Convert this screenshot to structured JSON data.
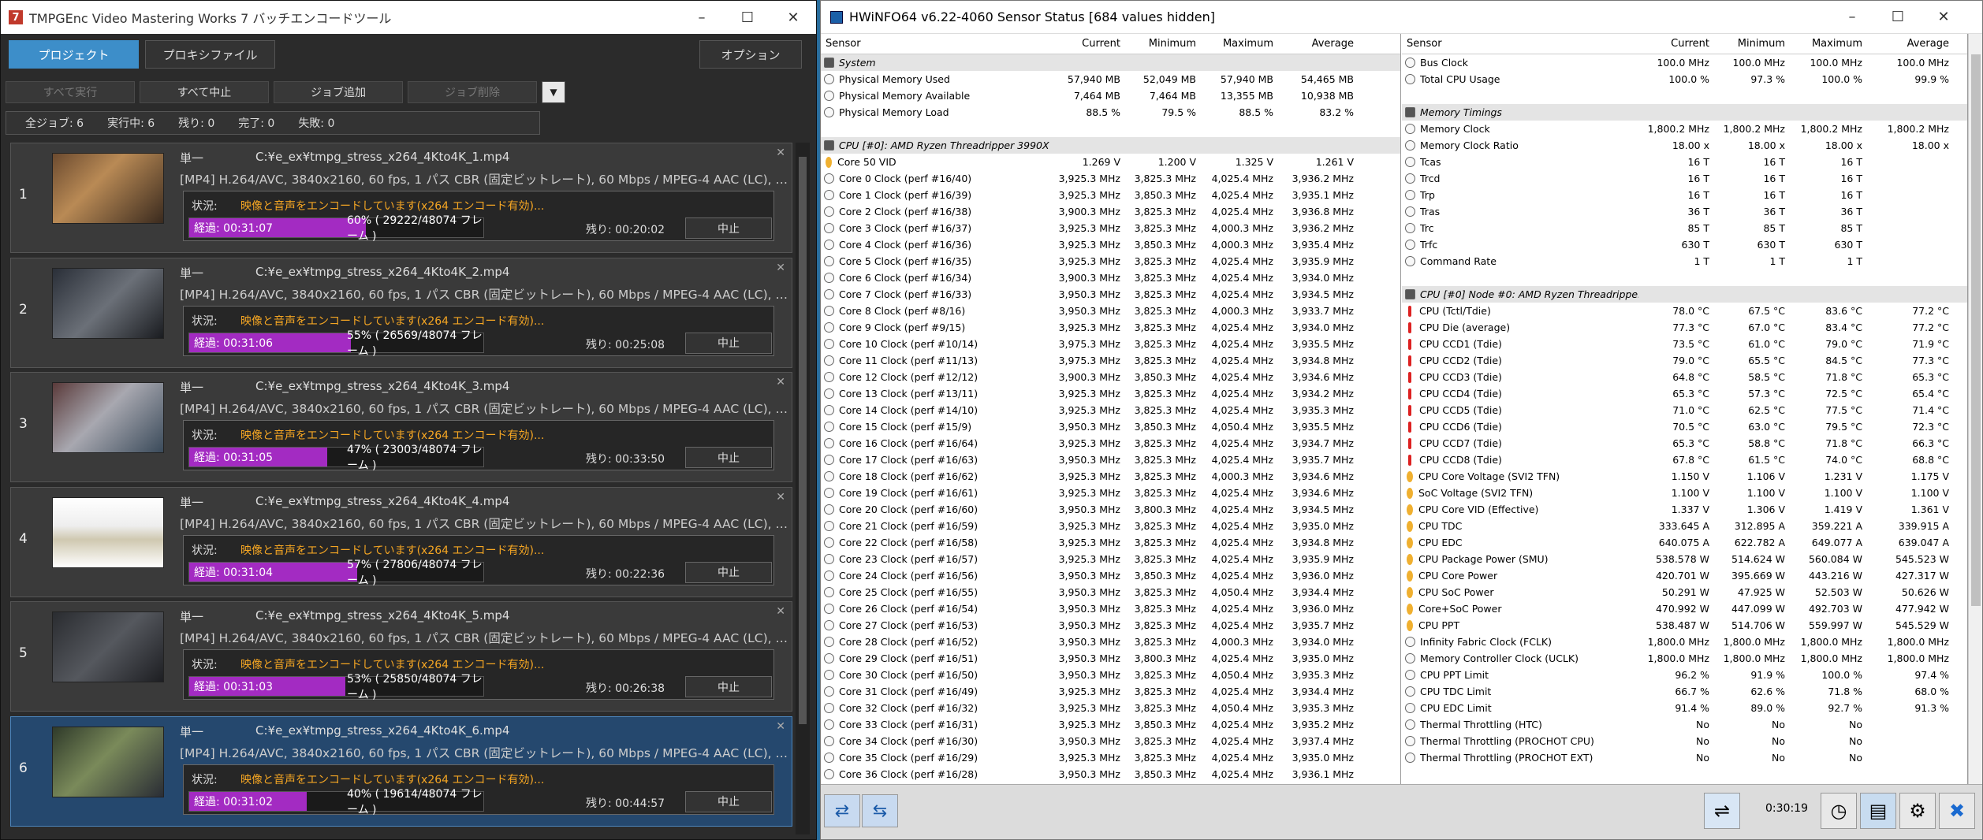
{
  "tmpg": {
    "title": "TMPGEnc Video Mastering Works 7 バッチエンコードツール",
    "tab_project": "プロジェクト",
    "tab_proxy": "プロキシファイル",
    "options": "オプション",
    "btn_run_all": "すべて実行",
    "btn_stop_all": "すべて中止",
    "btn_add_job": "ジョブ追加",
    "btn_delete_job": "ジョブ削除",
    "stats": {
      "total": "全ジョブ: 6",
      "running": "実行中: 6",
      "remaining": "残り: 0",
      "done": "完了: 0",
      "failed": "失敗: 0"
    },
    "status_label": "状況:",
    "stop_label": "中止",
    "job_type": "単一",
    "status_msg": "映像と音声をエンコードしています(x264 エンコード有効)...",
    "jobs": [
      {
        "num": "1",
        "path": "C:¥e_ex¥tmpg_stress_x264_4Kto4K_1.mp4",
        "info": "[MP4] H.264/AVC, 3840x2160, 60 fps, 1 パス CBR (固定ビットレート), 60 Mbps / MPEG-4 AAC (LC), 48000 ...",
        "elapsed": "経過: 00:31:07",
        "pct": "60%",
        "frames": "( 29222/48074 フレーム )",
        "progress": 0.6,
        "remain": "残り: 00:20:02"
      },
      {
        "num": "2",
        "path": "C:¥e_ex¥tmpg_stress_x264_4Kto4K_2.mp4",
        "info": "[MP4] H.264/AVC, 3840x2160, 60 fps, 1 パス CBR (固定ビットレート), 60 Mbps / MPEG-4 AAC (LC), 48000 ...",
        "elapsed": "経過: 00:31:06",
        "pct": "55%",
        "frames": "( 26569/48074 フレーム )",
        "progress": 0.55,
        "remain": "残り: 00:25:08"
      },
      {
        "num": "3",
        "path": "C:¥e_ex¥tmpg_stress_x264_4Kto4K_3.mp4",
        "info": "[MP4] H.264/AVC, 3840x2160, 60 fps, 1 パス CBR (固定ビットレート), 60 Mbps / MPEG-4 AAC (LC), 48000 ...",
        "elapsed": "経過: 00:31:05",
        "pct": "47%",
        "frames": "( 23003/48074 フレーム )",
        "progress": 0.47,
        "remain": "残り: 00:33:50"
      },
      {
        "num": "4",
        "path": "C:¥e_ex¥tmpg_stress_x264_4Kto4K_4.mp4",
        "info": "[MP4] H.264/AVC, 3840x2160, 60 fps, 1 パス CBR (固定ビットレート), 60 Mbps / MPEG-4 AAC (LC), 48000 ...",
        "elapsed": "経過: 00:31:04",
        "pct": "57%",
        "frames": "( 27806/48074 フレーム )",
        "progress": 0.57,
        "remain": "残り: 00:22:36"
      },
      {
        "num": "5",
        "path": "C:¥e_ex¥tmpg_stress_x264_4Kto4K_5.mp4",
        "info": "[MP4] H.264/AVC, 3840x2160, 60 fps, 1 パス CBR (固定ビットレート), 60 Mbps / MPEG-4 AAC (LC), 48000 ...",
        "elapsed": "経過: 00:31:03",
        "pct": "53%",
        "frames": "( 25850/48074 フレーム )",
        "progress": 0.53,
        "remain": "残り: 00:26:38"
      },
      {
        "num": "6",
        "path": "C:¥e_ex¥tmpg_stress_x264_4Kto4K_6.mp4",
        "info": "[MP4] H.264/AVC, 3840x2160, 60 fps, 1 パス CBR (固定ビットレート), 60 Mbps / MPEG-4 AAC (LC), 48000 ...",
        "elapsed": "経過: 00:31:02",
        "pct": "40%",
        "frames": "( 19614/48074 フレーム )",
        "progress": 0.4,
        "remain": "残り: 00:44:57"
      }
    ]
  },
  "hw": {
    "title": "HWiNFO64 v6.22-4060 Sensor Status [684 values hidden]",
    "headers": [
      "Sensor",
      "Current",
      "Minimum",
      "Maximum",
      "Average"
    ],
    "timer": "0:30:19",
    "left": [
      [
        "#s",
        "System"
      ],
      [
        "Physical Memory Used",
        "57,940 MB",
        "52,049 MB",
        "57,940 MB",
        "54,465 MB"
      ],
      [
        "Physical Memory Available",
        "7,464 MB",
        "7,464 MB",
        "13,355 MB",
        "10,938 MB"
      ],
      [
        "Physical Memory Load",
        "88.5 %",
        "79.5 %",
        "88.5 %",
        "83.2 %"
      ],
      [
        "#b"
      ],
      [
        "#s",
        "CPU [#0]: AMD Ryzen Threadripper 3990X"
      ],
      [
        "!Core 50 VID",
        "1.269 V",
        "1.200 V",
        "1.325 V",
        "1.261 V"
      ],
      [
        "Core 0 Clock (perf #16/40)",
        "3,925.3 MHz",
        "3,825.3 MHz",
        "4,025.4 MHz",
        "3,936.2 MHz"
      ],
      [
        "Core 1 Clock (perf #16/39)",
        "3,925.3 MHz",
        "3,850.3 MHz",
        "4,025.4 MHz",
        "3,935.1 MHz"
      ],
      [
        "Core 2 Clock (perf #16/38)",
        "3,900.3 MHz",
        "3,825.3 MHz",
        "4,025.4 MHz",
        "3,936.8 MHz"
      ],
      [
        "Core 3 Clock (perf #16/37)",
        "3,925.3 MHz",
        "3,825.3 MHz",
        "4,000.3 MHz",
        "3,936.2 MHz"
      ],
      [
        "Core 4 Clock (perf #16/36)",
        "3,925.3 MHz",
        "3,850.3 MHz",
        "4,000.3 MHz",
        "3,935.4 MHz"
      ],
      [
        "Core 5 Clock (perf #16/35)",
        "3,925.3 MHz",
        "3,825.3 MHz",
        "4,025.4 MHz",
        "3,935.9 MHz"
      ],
      [
        "Core 6 Clock (perf #16/34)",
        "3,900.3 MHz",
        "3,825.3 MHz",
        "4,025.4 MHz",
        "3,934.0 MHz"
      ],
      [
        "Core 7 Clock (perf #16/33)",
        "3,950.3 MHz",
        "3,825.3 MHz",
        "4,025.4 MHz",
        "3,934.5 MHz"
      ],
      [
        "Core 8 Clock (perf #8/16)",
        "3,950.3 MHz",
        "3,825.3 MHz",
        "4,000.3 MHz",
        "3,933.7 MHz"
      ],
      [
        "Core 9 Clock (perf #9/15)",
        "3,925.3 MHz",
        "3,825.3 MHz",
        "4,025.4 MHz",
        "3,934.0 MHz"
      ],
      [
        "Core 10 Clock (perf #10/14)",
        "3,975.3 MHz",
        "3,825.3 MHz",
        "4,025.4 MHz",
        "3,935.5 MHz"
      ],
      [
        "Core 11 Clock (perf #11/13)",
        "3,975.3 MHz",
        "3,825.3 MHz",
        "4,025.4 MHz",
        "3,934.8 MHz"
      ],
      [
        "Core 12 Clock (perf #12/12)",
        "3,900.3 MHz",
        "3,850.3 MHz",
        "4,025.4 MHz",
        "3,934.6 MHz"
      ],
      [
        "Core 13 Clock (perf #13/11)",
        "3,925.3 MHz",
        "3,825.3 MHz",
        "4,025.4 MHz",
        "3,934.2 MHz"
      ],
      [
        "Core 14 Clock (perf #14/10)",
        "3,925.3 MHz",
        "3,825.3 MHz",
        "4,025.4 MHz",
        "3,935.3 MHz"
      ],
      [
        "Core 15 Clock (perf #15/9)",
        "3,950.3 MHz",
        "3,850.3 MHz",
        "4,050.4 MHz",
        "3,935.5 MHz"
      ],
      [
        "Core 16 Clock (perf #16/64)",
        "3,925.3 MHz",
        "3,825.3 MHz",
        "4,025.4 MHz",
        "3,934.7 MHz"
      ],
      [
        "Core 17 Clock (perf #16/63)",
        "3,950.3 MHz",
        "3,825.3 MHz",
        "4,025.4 MHz",
        "3,935.7 MHz"
      ],
      [
        "Core 18 Clock (perf #16/62)",
        "3,925.3 MHz",
        "3,825.3 MHz",
        "4,000.3 MHz",
        "3,934.6 MHz"
      ],
      [
        "Core 19 Clock (perf #16/61)",
        "3,925.3 MHz",
        "3,825.3 MHz",
        "4,025.4 MHz",
        "3,934.6 MHz"
      ],
      [
        "Core 20 Clock (perf #16/60)",
        "3,950.3 MHz",
        "3,800.3 MHz",
        "4,025.4 MHz",
        "3,934.5 MHz"
      ],
      [
        "Core 21 Clock (perf #16/59)",
        "3,925.3 MHz",
        "3,825.3 MHz",
        "4,025.4 MHz",
        "3,935.0 MHz"
      ],
      [
        "Core 22 Clock (perf #16/58)",
        "3,925.3 MHz",
        "3,825.3 MHz",
        "4,025.4 MHz",
        "3,934.8 MHz"
      ],
      [
        "Core 23 Clock (perf #16/57)",
        "3,925.3 MHz",
        "3,825.3 MHz",
        "4,025.4 MHz",
        "3,935.9 MHz"
      ],
      [
        "Core 24 Clock (perf #16/56)",
        "3,950.3 MHz",
        "3,850.3 MHz",
        "4,025.4 MHz",
        "3,936.0 MHz"
      ],
      [
        "Core 25 Clock (perf #16/55)",
        "3,950.3 MHz",
        "3,825.3 MHz",
        "4,050.4 MHz",
        "3,934.4 MHz"
      ],
      [
        "Core 26 Clock (perf #16/54)",
        "3,950.3 MHz",
        "3,825.3 MHz",
        "4,025.4 MHz",
        "3,936.0 MHz"
      ],
      [
        "Core 27 Clock (perf #16/53)",
        "3,950.3 MHz",
        "3,825.3 MHz",
        "4,025.4 MHz",
        "3,935.7 MHz"
      ],
      [
        "Core 28 Clock (perf #16/52)",
        "3,950.3 MHz",
        "3,825.3 MHz",
        "4,000.3 MHz",
        "3,934.0 MHz"
      ],
      [
        "Core 29 Clock (perf #16/51)",
        "3,950.3 MHz",
        "3,800.3 MHz",
        "4,025.4 MHz",
        "3,935.0 MHz"
      ],
      [
        "Core 30 Clock (perf #16/50)",
        "3,950.3 MHz",
        "3,825.3 MHz",
        "4,050.4 MHz",
        "3,935.3 MHz"
      ],
      [
        "Core 31 Clock (perf #16/49)",
        "3,925.3 MHz",
        "3,825.3 MHz",
        "4,025.4 MHz",
        "3,934.4 MHz"
      ],
      [
        "Core 32 Clock (perf #16/32)",
        "3,925.3 MHz",
        "3,825.3 MHz",
        "4,050.4 MHz",
        "3,935.3 MHz"
      ],
      [
        "Core 33 Clock (perf #16/31)",
        "3,925.3 MHz",
        "3,850.3 MHz",
        "4,025.4 MHz",
        "3,935.2 MHz"
      ],
      [
        "Core 34 Clock (perf #16/30)",
        "3,950.3 MHz",
        "3,825.3 MHz",
        "4,025.4 MHz",
        "3,937.4 MHz"
      ],
      [
        "Core 35 Clock (perf #16/29)",
        "3,925.3 MHz",
        "3,825.3 MHz",
        "4,025.4 MHz",
        "3,935.0 MHz"
      ],
      [
        "Core 36 Clock (perf #16/28)",
        "3,950.3 MHz",
        "3,850.3 MHz",
        "4,025.4 MHz",
        "3,936.1 MHz"
      ]
    ],
    "right": [
      [
        "Bus Clock",
        "100.0 MHz",
        "100.0 MHz",
        "100.0 MHz",
        "100.0 MHz"
      ],
      [
        "Total CPU Usage",
        "100.0 %",
        "97.3 %",
        "100.0 %",
        "99.9 %"
      ],
      [
        "#b"
      ],
      [
        "#s",
        "Memory Timings"
      ],
      [
        "Memory Clock",
        "1,800.2 MHz",
        "1,800.2 MHz",
        "1,800.2 MHz",
        "1,800.2 MHz"
      ],
      [
        "Memory Clock Ratio",
        "18.00 x",
        "18.00 x",
        "18.00 x",
        "18.00 x"
      ],
      [
        "Tcas",
        "16 T",
        "16 T",
        "16 T",
        ""
      ],
      [
        "Trcd",
        "16 T",
        "16 T",
        "16 T",
        ""
      ],
      [
        "Trp",
        "16 T",
        "16 T",
        "16 T",
        ""
      ],
      [
        "Tras",
        "36 T",
        "36 T",
        "36 T",
        ""
      ],
      [
        "Trc",
        "85 T",
        "85 T",
        "85 T",
        ""
      ],
      [
        "Trfc",
        "630 T",
        "630 T",
        "630 T",
        ""
      ],
      [
        "Command Rate",
        "1 T",
        "1 T",
        "1 T",
        ""
      ],
      [
        "#b"
      ],
      [
        "#s",
        "CPU [#0] Node #0: AMD Ryzen Threadripper ..."
      ],
      [
        "^CPU (Tctl/Tdie)",
        "78.0 °C",
        "67.5 °C",
        "83.6 °C",
        "77.2 °C"
      ],
      [
        "^CPU Die (average)",
        "77.3 °C",
        "67.0 °C",
        "83.4 °C",
        "77.2 °C"
      ],
      [
        "^CPU CCD1 (Tdie)",
        "73.5 °C",
        "61.0 °C",
        "79.0 °C",
        "71.9 °C"
      ],
      [
        "^CPU CCD2 (Tdie)",
        "79.0 °C",
        "65.5 °C",
        "84.5 °C",
        "77.3 °C"
      ],
      [
        "^CPU CCD3 (Tdie)",
        "64.8 °C",
        "58.5 °C",
        "71.8 °C",
        "65.3 °C"
      ],
      [
        "^CPU CCD4 (Tdie)",
        "65.3 °C",
        "57.3 °C",
        "72.5 °C",
        "65.4 °C"
      ],
      [
        "^CPU CCD5 (Tdie)",
        "71.0 °C",
        "62.5 °C",
        "77.5 °C",
        "71.4 °C"
      ],
      [
        "^CPU CCD6 (Tdie)",
        "70.5 °C",
        "63.0 °C",
        "79.5 °C",
        "72.3 °C"
      ],
      [
        "^CPU CCD7 (Tdie)",
        "65.3 °C",
        "58.8 °C",
        "71.8 °C",
        "66.3 °C"
      ],
      [
        "^CPU CCD8 (Tdie)",
        "67.8 °C",
        "61.5 °C",
        "74.0 °C",
        "68.8 °C"
      ],
      [
        "!CPU Core Voltage (SVI2 TFN)",
        "1.150 V",
        "1.106 V",
        "1.231 V",
        "1.175 V"
      ],
      [
        "!SoC Voltage (SVI2 TFN)",
        "1.100 V",
        "1.100 V",
        "1.100 V",
        "1.100 V"
      ],
      [
        "!CPU Core VID (Effective)",
        "1.337 V",
        "1.306 V",
        "1.419 V",
        "1.361 V"
      ],
      [
        "!CPU TDC",
        "333.645 A",
        "312.895 A",
        "359.221 A",
        "339.915 A"
      ],
      [
        "!CPU EDC",
        "640.075 A",
        "622.782 A",
        "649.077 A",
        "639.047 A"
      ],
      [
        "!CPU Package Power (SMU)",
        "538.578 W",
        "514.624 W",
        "560.084 W",
        "545.523 W"
      ],
      [
        "!CPU Core Power",
        "420.701 W",
        "395.669 W",
        "443.216 W",
        "427.317 W"
      ],
      [
        "!CPU SoC Power",
        "50.291 W",
        "47.925 W",
        "52.503 W",
        "50.626 W"
      ],
      [
        "!Core+SoC Power",
        "470.992 W",
        "447.099 W",
        "492.703 W",
        "477.942 W"
      ],
      [
        "!CPU PPT",
        "538.487 W",
        "514.706 W",
        "559.997 W",
        "545.529 W"
      ],
      [
        "Infinity Fabric Clock (FCLK)",
        "1,800.0 MHz",
        "1,800.0 MHz",
        "1,800.0 MHz",
        "1,800.0 MHz"
      ],
      [
        "Memory Controller Clock (UCLK)",
        "1,800.0 MHz",
        "1,800.0 MHz",
        "1,800.0 MHz",
        "1,800.0 MHz"
      ],
      [
        "CPU PPT Limit",
        "96.2 %",
        "91.9 %",
        "100.0 %",
        "97.4 %"
      ],
      [
        "CPU TDC Limit",
        "66.7 %",
        "62.6 %",
        "71.8 %",
        "68.0 %"
      ],
      [
        "CPU EDC Limit",
        "91.4 %",
        "89.0 %",
        "92.7 %",
        "91.3 %"
      ],
      [
        "Thermal Throttling (HTC)",
        "No",
        "No",
        "No",
        ""
      ],
      [
        "Thermal Throttling (PROCHOT CPU)",
        "No",
        "No",
        "No",
        ""
      ],
      [
        "Thermal Throttling (PROCHOT EXT)",
        "No",
        "No",
        "No",
        ""
      ]
    ]
  }
}
